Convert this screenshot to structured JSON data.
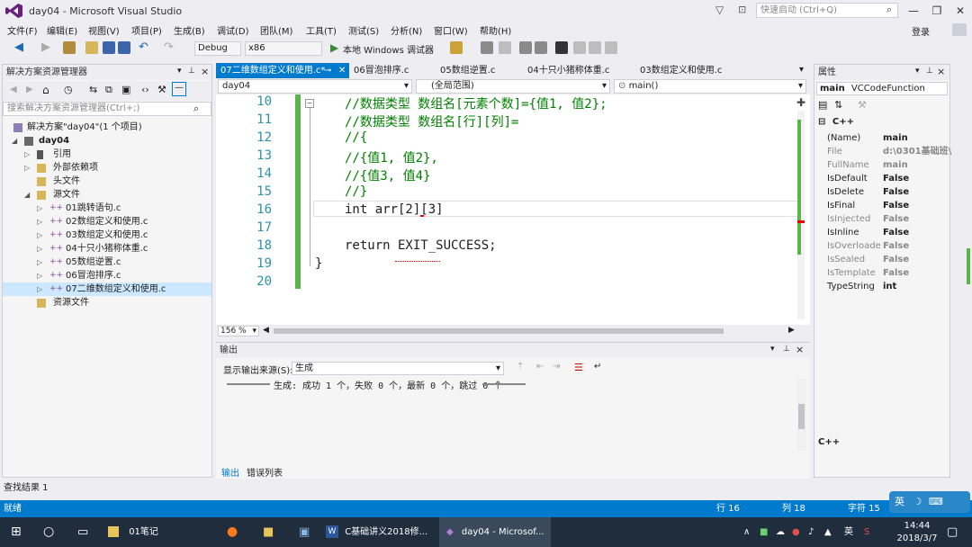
{
  "window": {
    "title": "day04 - Microsoft Visual Studio",
    "quick_launch": "快速启动 (Ctrl+Q)",
    "login": "登录"
  },
  "menu": [
    "文件(F)",
    "编辑(E)",
    "视图(V)",
    "项目(P)",
    "生成(B)",
    "调试(D)",
    "团队(M)",
    "工具(T)",
    "测试(S)",
    "分析(N)",
    "窗口(W)",
    "帮助(H)"
  ],
  "toolbar": {
    "config": "Debug",
    "platform": "x86",
    "run_label": "本地 Windows 调试器"
  },
  "solution_explorer": {
    "title": "解决方案资源管理器",
    "search_placeholder": "搜索解决方案资源管理器(Ctrl+;)",
    "solution": "解决方案\"day04\"(1 个项目)",
    "project": "day04",
    "nodes": [
      "引用",
      "外部依赖项",
      "头文件",
      "源文件"
    ],
    "files": [
      "01跳转语句.c",
      "02数组定义和使用.c",
      "03数组定义和使用.c",
      "04十只小猪称体重.c",
      "05数组逆置.c",
      "06冒泡排序.c",
      "07二维数组定义和使用.c"
    ],
    "resources": "资源文件"
  },
  "editor": {
    "tabs": [
      "07二维数组定义和使用.c*",
      "06冒泡排序.c",
      "05数组逆置.c",
      "04十只小猪称体重.c",
      "03数组定义和使用.c"
    ],
    "nav": {
      "project": "day04",
      "scope": "(全局范围)",
      "func": "main()"
    },
    "lines": [
      {
        "n": "10",
        "text": "//数据类型 数组名[元素个数]={值1, 值2};",
        "cls": "cm"
      },
      {
        "n": "11",
        "text": "//数据类型 数组名[行][列]=",
        "cls": "cm"
      },
      {
        "n": "12",
        "text": "//{",
        "cls": "cm"
      },
      {
        "n": "13",
        "text": "//{值1, 值2},",
        "cls": "cm"
      },
      {
        "n": "14",
        "text": "//{值3, 值4}",
        "cls": "cm"
      },
      {
        "n": "15",
        "text": "//}",
        "cls": "cm"
      },
      {
        "n": "16",
        "text": "int arr[2][3]",
        "cls": "tx"
      },
      {
        "n": "17",
        "text": "",
        "cls": "tx"
      },
      {
        "n": "18",
        "text": "return EXIT_SUCCESS;",
        "cls": "tx"
      },
      {
        "n": "19",
        "text": "}",
        "cls": "tx"
      },
      {
        "n": "20",
        "text": "",
        "cls": "tx"
      }
    ],
    "zoom": "156 %"
  },
  "output": {
    "title": "输出",
    "source_label": "显示输出来源(S):",
    "source_value": "生成",
    "message": "生成: 成功 1 个，失败 0 个，最新 0 个，跳过 0 个",
    "tabs": [
      "输出",
      "错误列表"
    ]
  },
  "properties": {
    "title": "属性",
    "object": "main",
    "object_type": "VCCodeFunction",
    "category": "C++",
    "rows": [
      {
        "name": "(Name)",
        "value": "main",
        "dim": false
      },
      {
        "name": "File",
        "value": "d:\\0301基础班\\0",
        "dim": true
      },
      {
        "name": "FullName",
        "value": "main",
        "dim": true
      },
      {
        "name": "IsDefault",
        "value": "False",
        "dim": false
      },
      {
        "name": "IsDelete",
        "value": "False",
        "dim": false
      },
      {
        "name": "IsFinal",
        "value": "False",
        "dim": false
      },
      {
        "name": "IsInjected",
        "value": "False",
        "dim": true
      },
      {
        "name": "IsInline",
        "value": "False",
        "dim": false
      },
      {
        "name": "IsOverloade",
        "value": "False",
        "dim": true
      },
      {
        "name": "IsSealed",
        "value": "False",
        "dim": true
      },
      {
        "name": "IsTemplate",
        "value": "False",
        "dim": true
      },
      {
        "name": "TypeString",
        "value": "int",
        "dim": false
      }
    ],
    "footer": "C++"
  },
  "find_results": "查找结果 1",
  "status": {
    "ready": "就绪",
    "line": "行 16",
    "col": "列 18",
    "char": "字符 15",
    "ime": "英"
  },
  "taskbar": {
    "items": [
      "01笔记",
      "C基础讲义2018修...",
      "day04 - Microsof..."
    ],
    "time": "14:44",
    "date": "2018/3/7",
    "lang": "英"
  },
  "colors": {
    "accent": "#007acc",
    "comment": "#008000",
    "keyword": "#0000ff",
    "line_number": "#2b91af"
  }
}
